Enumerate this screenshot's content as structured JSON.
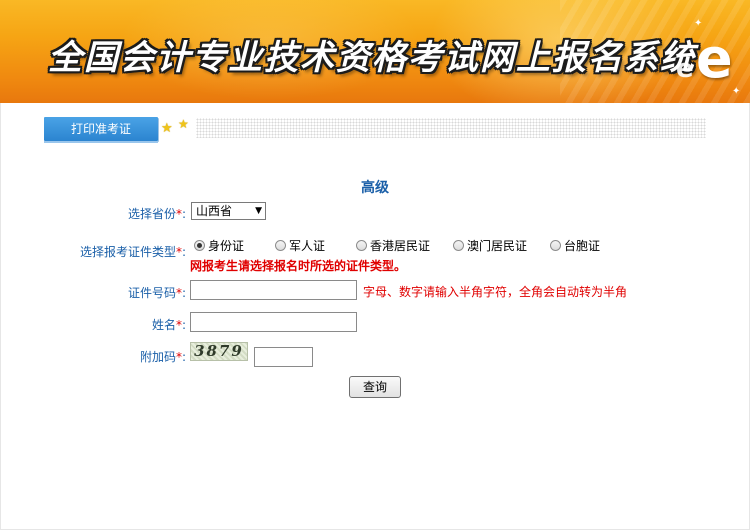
{
  "banner": {
    "title": "全国会计专业技术资格考试网上报名系统",
    "logo_letter_big": "e",
    "logo_letter_small": "e"
  },
  "toolbar": {
    "print_tab_label": "打印准考证",
    "star_icon": "star-icon"
  },
  "form": {
    "level_title": "高级",
    "province": {
      "label": "选择省份",
      "required_mark": "*",
      "colon": ":",
      "selected_value": "山西省"
    },
    "id_type": {
      "label": "选择报考证件类型",
      "required_mark": "*",
      "colon": ":",
      "options": [
        "身份证",
        "军人证",
        "香港居民证",
        "澳门居民证",
        "台胞证"
      ],
      "selected_index": 0,
      "note": "网报考生请选择报名时所选的证件类型。"
    },
    "id_number": {
      "label": "证件号码",
      "required_mark": "*",
      "colon": ":",
      "value": "",
      "hint": "字母、数字请输入半角字符，全角会自动转为半角"
    },
    "name": {
      "label": "姓名",
      "required_mark": "*",
      "colon": ":",
      "value": ""
    },
    "captcha": {
      "label": "附加码",
      "required_mark": "*",
      "colon": ":",
      "image_text": "3879",
      "value": ""
    },
    "submit_label": "查询"
  },
  "colors": {
    "label_blue": "#1a5fa8",
    "required_red": "#e00000",
    "tab_blue": "#2b84d0",
    "banner_orange": "#f6a514"
  }
}
